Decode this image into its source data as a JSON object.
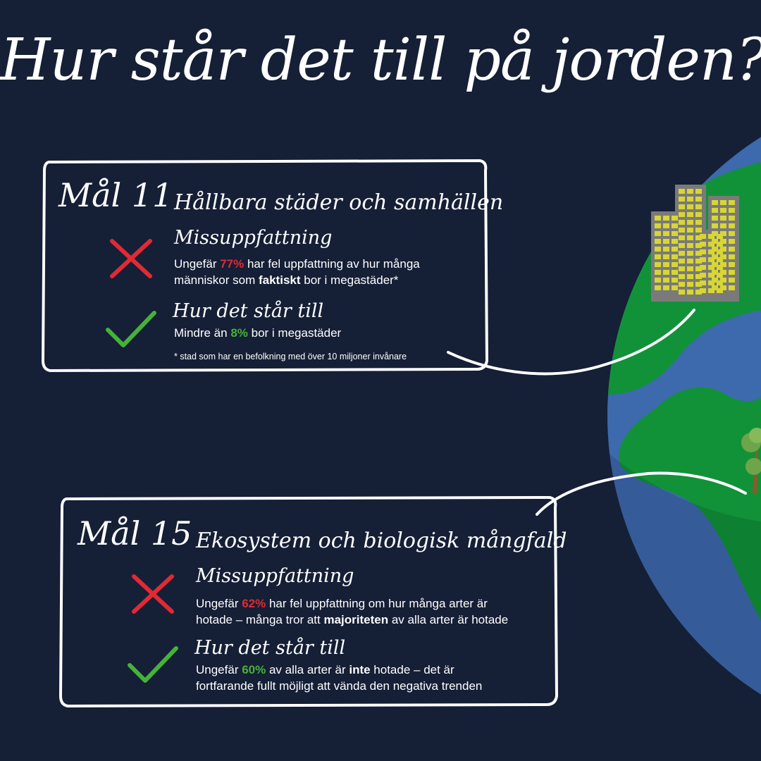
{
  "title": "Hur står det till på jorden?",
  "colors": {
    "background": "#151f36",
    "misconception_red": "#e02a35",
    "fact_green": "#45b23a",
    "globe_ocean": "#3d69ad",
    "globe_land": "#119239",
    "building": "#d8d632"
  },
  "icons": {
    "misconception": "red-cross-icon",
    "fact": "green-checkmark-icon"
  },
  "goals": [
    {
      "number_label": "Mål 11",
      "topic": "Hållbara städer och samhällen",
      "misconception": {
        "heading": "Missuppfattning",
        "line1_pre": "Ungefär ",
        "line1_pct": "77%",
        "line1_post": " har fel uppfattning av hur många",
        "line2_pre": "människor som ",
        "line2_bold": "faktiskt",
        "line2_post": " bor i megastäder*"
      },
      "fact": {
        "heading": "Hur det står till",
        "line1_pre": "Mindre än ",
        "line1_pct": "8%",
        "line1_post": " bor i megastäder"
      },
      "footnote": "* stad som har en befolkning med över 10 miljoner invånare"
    },
    {
      "number_label": "Mål 15",
      "topic": "Ekosystem och biologisk mångfald",
      "misconception": {
        "heading": "Missuppfattning",
        "line1_pre": "Ungefär ",
        "line1_pct": "62%",
        "line1_post": " har fel uppfattning om hur många arter är",
        "line2_pre": "hotade – många tror att ",
        "line2_bold": "majoriteten",
        "line2_post": " av alla arter är hotade"
      },
      "fact": {
        "heading": "Hur det står till",
        "line1_pre": "Ungefär ",
        "line1_pct": "60%",
        "line1_mid": " av alla arter är ",
        "line1_bold": "inte",
        "line1_post": " hotade – det är",
        "line2": "fortfarande fullt möjligt att vända den negativa trenden"
      }
    }
  ]
}
